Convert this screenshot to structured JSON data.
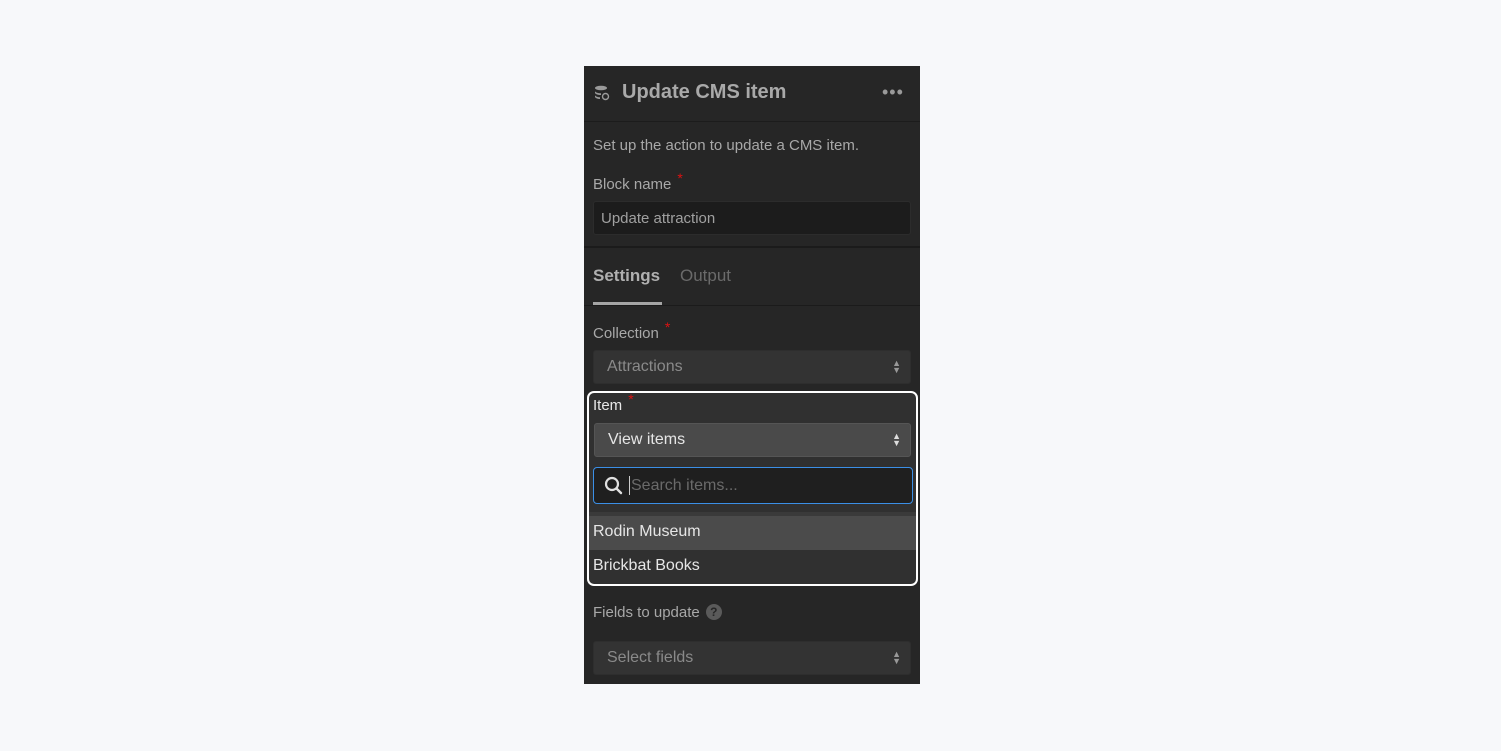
{
  "header": {
    "title": "Update CMS item",
    "icon": "database-sync-icon",
    "menu_icon": "more-horizontal-icon"
  },
  "description": "Set up the action to update a CMS item.",
  "block_name": {
    "label": "Block name",
    "required": "*",
    "value": "Update attraction"
  },
  "tabs": [
    {
      "label": "Settings",
      "active": true
    },
    {
      "label": "Output",
      "active": false
    }
  ],
  "collection": {
    "label": "Collection",
    "required": "*",
    "value": "Attractions"
  },
  "item": {
    "label": "Item",
    "required": "*",
    "value": "View items",
    "search_placeholder": "Search items...",
    "options": [
      "Rodin Museum",
      "Brickbat Books"
    ],
    "hovered": "Rodin Museum"
  },
  "fields": {
    "label": "Fields to update",
    "help": "?",
    "value": "Select fields"
  },
  "colors": {
    "panel": "#262626",
    "focus": "#3b8fe6",
    "required": "#dd1111",
    "highlight_border": "#ffffff"
  }
}
